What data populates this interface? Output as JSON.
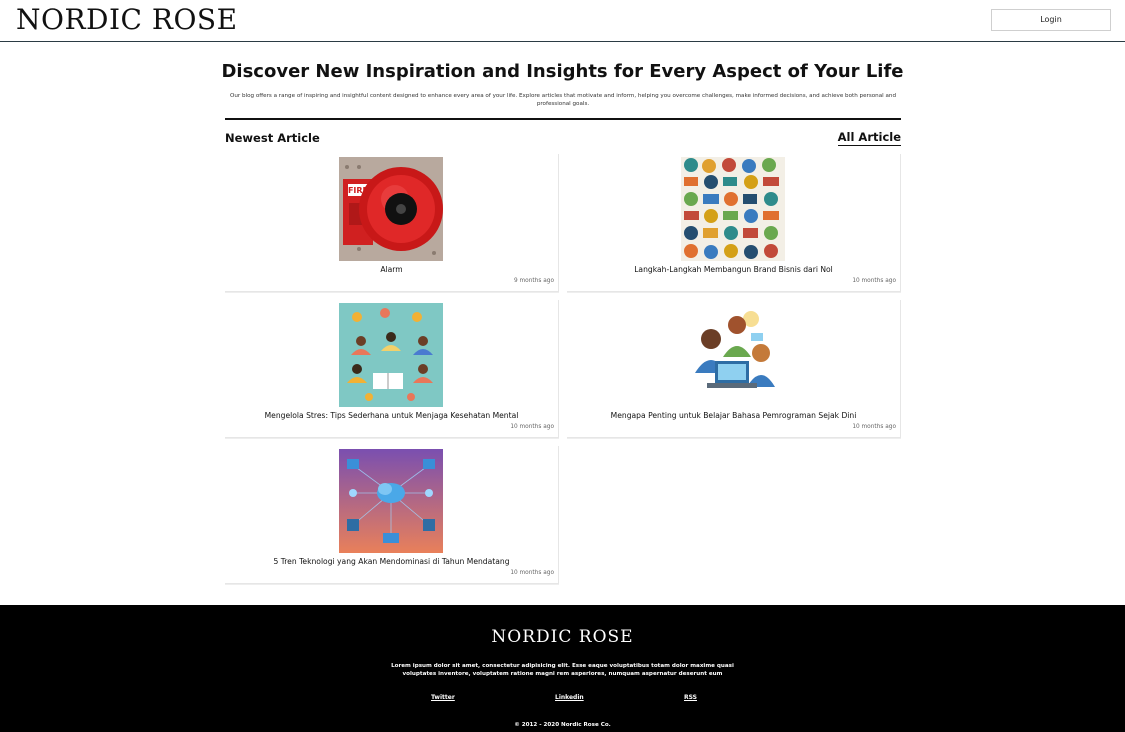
{
  "header": {
    "logo": "NORDIC ROSE",
    "login_label": "Login"
  },
  "hero": {
    "title": "Discover New Inspiration and Insights for Every Aspect of Your Life",
    "subtitle": "Our blog offers a range of inspiring and insightful content designed to enhance every area of your life. Explore articles that motivate and inform, helping you overcome challenges, make informed decisions, and achieve both personal and professional goals."
  },
  "section": {
    "title": "Newest Article",
    "all_link": "All Article"
  },
  "articles": [
    {
      "title": "Alarm",
      "date": "9 months ago",
      "image": "fire-alarm-bell"
    },
    {
      "title": "Langkah-Langkah Membangun Brand Bisnis dari Nol",
      "date": "10 months ago",
      "image": "brand-logos-collage"
    },
    {
      "title": "Mengelola Stres: Tips Sederhana untuk Menjaga Kesehatan Mental",
      "date": "10 months ago",
      "image": "meditation-illustration"
    },
    {
      "title": "Mengapa Penting untuk Belajar Bahasa Pemrograman Sejak Dini",
      "date": "10 months ago",
      "image": "kids-coding-illustration"
    },
    {
      "title": "5 Tren Teknologi yang Akan Mendominasi di Tahun Mendatang",
      "date": "10 months ago",
      "image": "technology-network-illustration"
    }
  ],
  "footer": {
    "logo": "NORDIC ROSE",
    "text": "Lorem ipsum dolor sit amet, consectetur adipisicing elit. Esse eaque voluptatibus totam dolor maxime quasi voluptates inventore, voluptatem ratione magni rem asperiores, numquam aspernatur deserunt eum",
    "links": [
      "Twitter",
      "Linkedin",
      "RSS"
    ],
    "copyright": "© 2012 - 2020 Nordic Rose Co."
  },
  "colors": {
    "header_border": "#2b3b44",
    "footer_bg": "#000000",
    "card_border": "#e6e6e6"
  }
}
